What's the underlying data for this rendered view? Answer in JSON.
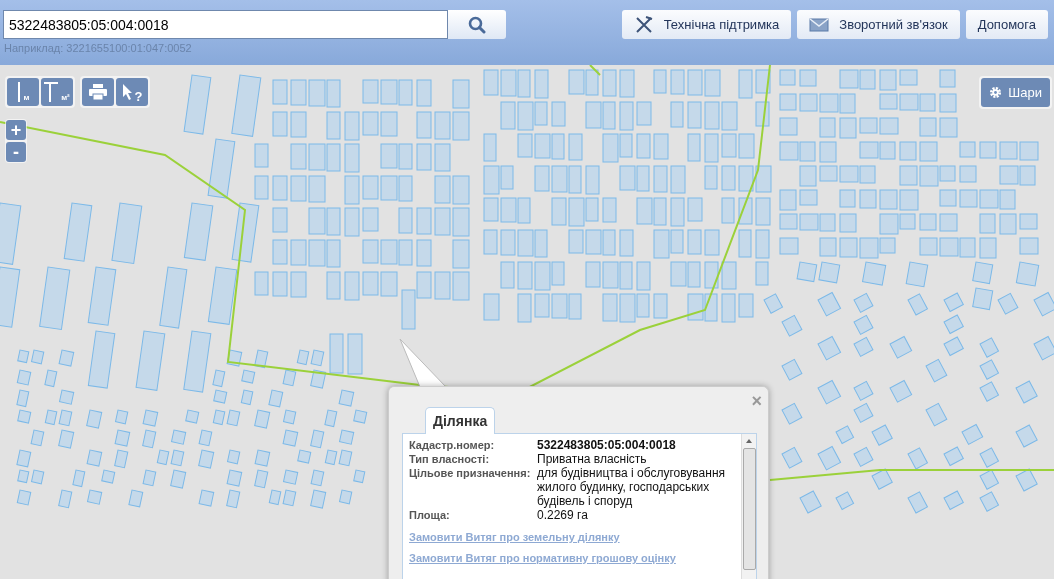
{
  "search": {
    "value": "5322483805:05:004:0018",
    "hint": "Наприклад: 3221655100:01:047:0052"
  },
  "header_buttons": [
    {
      "kind": "support",
      "label": "Технічна підтримка"
    },
    {
      "kind": "feedback",
      "label": "Зворотний зв'язок"
    },
    {
      "kind": "help",
      "label": "Допомога"
    }
  ],
  "map_tools": [
    {
      "kind": "distance",
      "label": "м"
    },
    {
      "kind": "area",
      "label": "м²"
    },
    {
      "kind": "print"
    },
    {
      "kind": "identify",
      "label": "?"
    }
  ],
  "zoom": [
    "+",
    "-"
  ],
  "layers_button": {
    "label": "Шари"
  },
  "popup": {
    "close": "×",
    "tabs": [
      {
        "label": "Ділянка",
        "selected": true
      }
    ],
    "fields": [
      {
        "label": "Кадастр.номер:",
        "value": "5322483805:05:004:0018",
        "kind": "bold"
      },
      {
        "label": "Тип власності:",
        "value": "Приватна власність",
        "kind": "plain"
      },
      {
        "label": "Цільове призначення:",
        "value": "для будівництва і обслуговування жилого будинку, господарських будівель і споруд",
        "kind": "plain"
      },
      {
        "label": "Площа:",
        "value": "0.2269 га",
        "kind": "plain"
      }
    ],
    "links": [
      "Замовити Витяг про земельну ділянку",
      "Замовити Витяг про нормативну грошову оцінку"
    ]
  }
}
